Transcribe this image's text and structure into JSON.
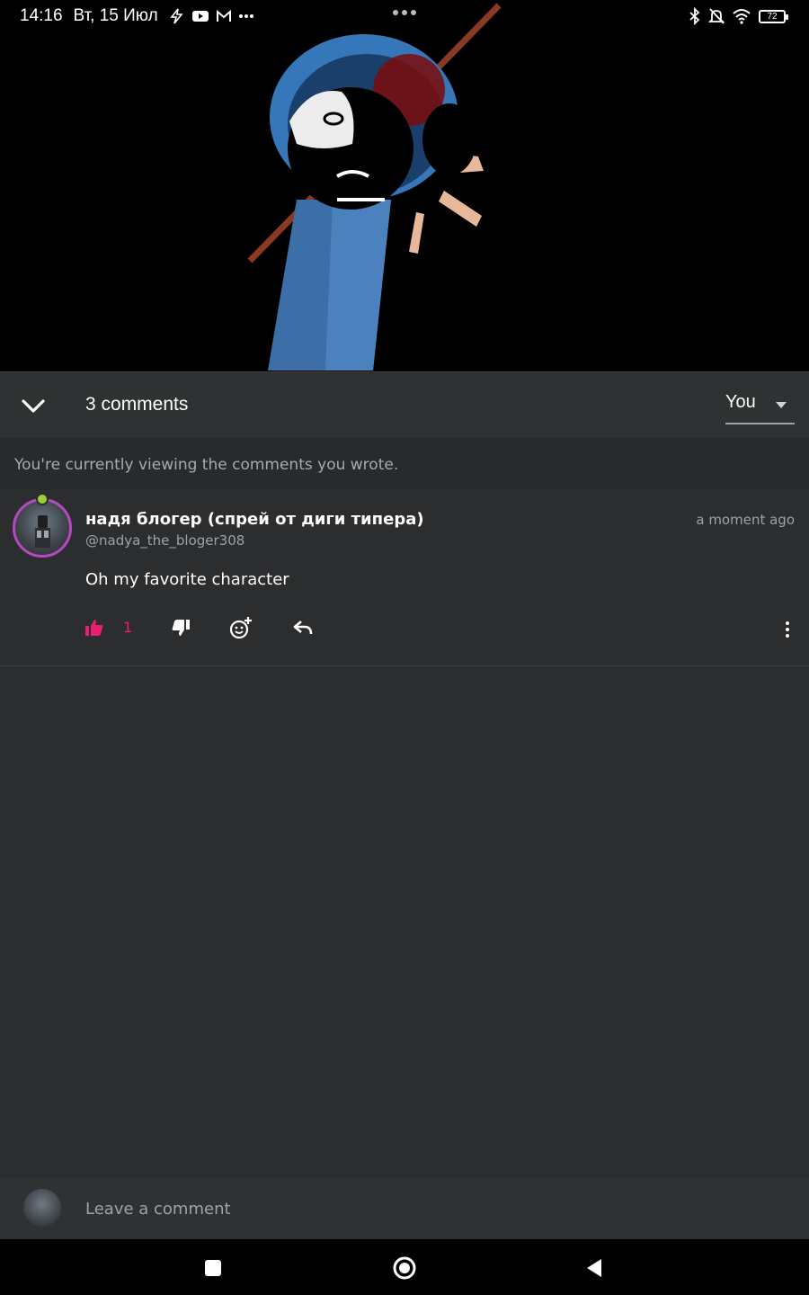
{
  "status_bar": {
    "time": "14:16",
    "date": "Вт, 15 Июл",
    "battery": "72"
  },
  "header": {
    "count_label": "3 comments",
    "filter_value": "You"
  },
  "info_text": "You're currently viewing the comments you wrote.",
  "comment": {
    "author": "надя блогер (спрей от диги типера)",
    "handle": "@nadya_the_bloger308",
    "time": "a moment ago",
    "text": "Oh my favorite character",
    "like_count": "1"
  },
  "composer": {
    "placeholder": "Leave a comment"
  },
  "colors": {
    "accent": "#e91e73",
    "background": "#2b2d2e",
    "header": "#2f3233"
  },
  "icons": [
    "chevron-down-icon",
    "caret-down-icon",
    "thumbs-up-icon",
    "thumbs-down-icon",
    "add-reaction-icon",
    "reply-icon",
    "more-vert-icon",
    "recents-icon",
    "home-icon",
    "back-icon"
  ]
}
